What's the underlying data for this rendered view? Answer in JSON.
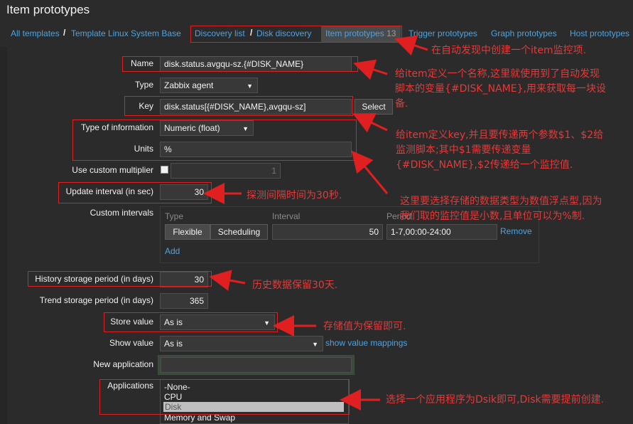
{
  "page": {
    "title": "Item prototypes"
  },
  "breadcrumbs": {
    "all_templates": "All templates",
    "template": "Template Linux System Base",
    "discovery_list": "Discovery list",
    "disk_discovery": "Disk discovery",
    "item_prototypes": "Item prototypes",
    "item_prototypes_count": "13",
    "trigger_prototypes": "Trigger prototypes",
    "graph_prototypes": "Graph prototypes",
    "host_prototypes": "Host prototypes"
  },
  "form": {
    "name_label": "Name",
    "name_value": "disk.status.avgqu-sz.{#DISK_NAME}",
    "type_label": "Type",
    "type_value": "Zabbix agent",
    "key_label": "Key",
    "key_value": "disk.status[{#DISK_NAME},avgqu-sz]",
    "select_button": "Select",
    "type_info_label": "Type of information",
    "type_info_value": "Numeric (float)",
    "units_label": "Units",
    "units_value": "%",
    "custom_multiplier_label": "Use custom multiplier",
    "custom_multiplier_value": "1",
    "update_interval_label": "Update interval (in sec)",
    "update_interval_value": "30",
    "custom_intervals_label": "Custom intervals",
    "ci_col_type": "Type",
    "ci_col_interval": "Interval",
    "ci_col_period": "Period",
    "ci_flexible": "Flexible",
    "ci_scheduling": "Scheduling",
    "ci_interval_value": "50",
    "ci_period_value": "1-7,00:00-24:00",
    "ci_remove": "Remove",
    "ci_add": "Add",
    "history_label": "History storage period (in days)",
    "history_value": "30",
    "trend_label": "Trend storage period (in days)",
    "trend_value": "365",
    "store_value_label": "Store value",
    "store_value_value": "As is",
    "show_value_label": "Show value",
    "show_value_value": "As is",
    "show_value_mappings": "show value mappings",
    "new_application_label": "New application",
    "new_application_value": "",
    "applications_label": "Applications",
    "applications": [
      "-None-",
      "CPU",
      "Disk",
      "Memory and Swap"
    ]
  },
  "annotations": {
    "a1": "在自动发现中创建一个item监控项.",
    "a2_line1": "给item定义一个名称,这里就使用到了自动发现",
    "a2_line2": "脚本的变量{#DISK_NAME},用来获取每一块设",
    "a2_line3": "备.",
    "a3_line1": "给item定义key,并且要传递两个参数$1、$2给",
    "a3_line2": "监测脚本;其中$1需要传递变量",
    "a3_line3": "{#DISK_NAME},$2传递给一个监控值.",
    "a4": "探测间隔时间为30秒.",
    "a5_line1": "这里要选择存储的数据类型为数值浮点型,因为",
    "a5_line2": "我们取的监控值是小数,且单位可以为%制.",
    "a6": "历史数据保留30天.",
    "a7": "存储值为保留即可.",
    "a8": "选择一个应用程序为Dsik即可,Disk需要提前创建."
  },
  "colors": {
    "annotation_red": "#e02020",
    "link_blue": "#4fa3e0",
    "background": "#2b2b2b"
  }
}
